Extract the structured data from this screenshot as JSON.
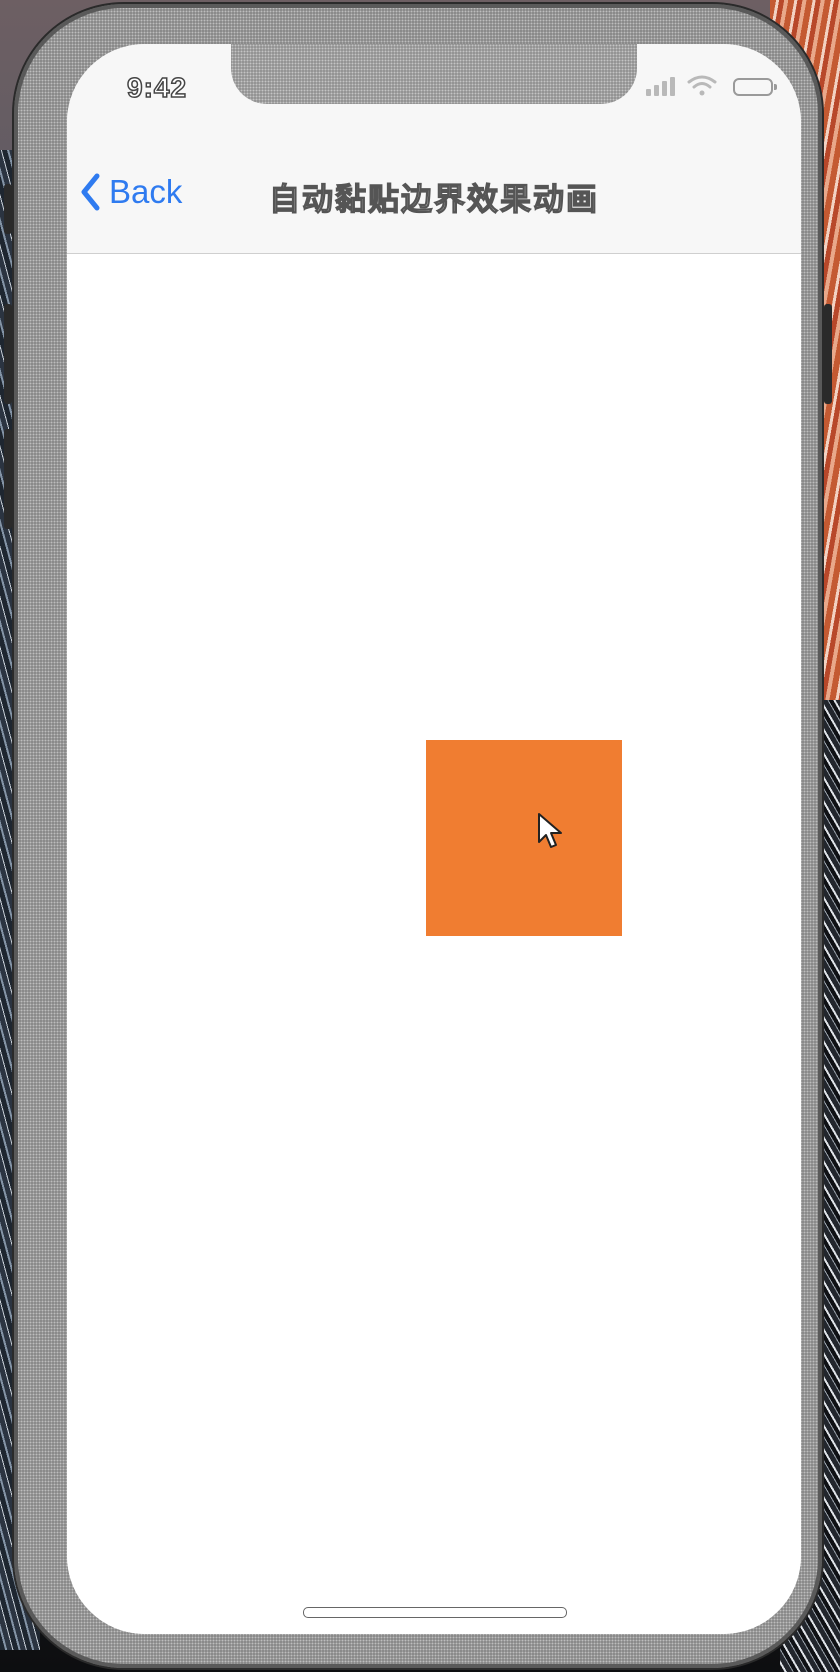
{
  "status_bar": {
    "time": "9:42",
    "signal_icon": "cellular-signal-icon",
    "wifi_icon": "wifi-icon",
    "battery_icon": "battery-icon"
  },
  "nav_bar": {
    "back_label": "Back",
    "back_icon": "chevron-left-icon",
    "title": "自动黏贴边界效果动画"
  },
  "content": {
    "draggable_view_color": "#f07d31",
    "pointer_icon": "mouse-pointer-icon"
  },
  "colors": {
    "accent": "#2f7bf0",
    "bar_background": "#f7f7f7",
    "content_background": "#ffffff"
  }
}
